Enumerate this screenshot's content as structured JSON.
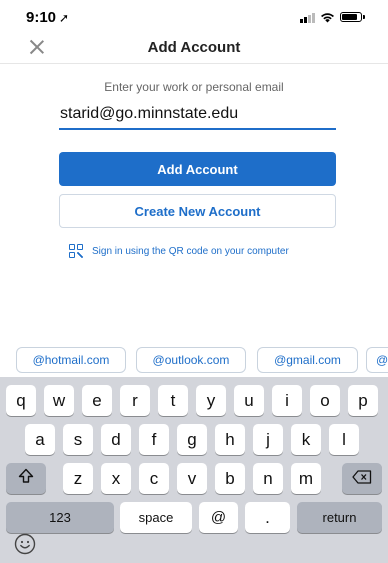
{
  "status": {
    "time": "9:10",
    "location_glyph": "➚"
  },
  "nav": {
    "title": "Add Account"
  },
  "form": {
    "prompt": "Enter your work or personal email",
    "email_value": "starid@go.minnstate.edu",
    "add_account_label": "Add Account",
    "create_account_label": "Create New Account",
    "qr_label": "Sign in using the QR code on your computer"
  },
  "suggestions": [
    "@hotmail.com",
    "@outlook.com",
    "@gmail.com",
    "@"
  ],
  "keyboard": {
    "row1": [
      "q",
      "w",
      "e",
      "r",
      "t",
      "y",
      "u",
      "i",
      "o",
      "p"
    ],
    "row2": [
      "a",
      "s",
      "d",
      "f",
      "g",
      "h",
      "j",
      "k",
      "l"
    ],
    "row3": [
      "z",
      "x",
      "c",
      "v",
      "b",
      "n",
      "m"
    ],
    "numbers_label": "123",
    "space_label": "space",
    "at_label": "@",
    "dot_label": ".",
    "return_label": "return"
  },
  "colors": {
    "accent": "#1e6ec9",
    "keyboard_bg": "#d3d5db",
    "key_dark": "#aeb3bd"
  }
}
